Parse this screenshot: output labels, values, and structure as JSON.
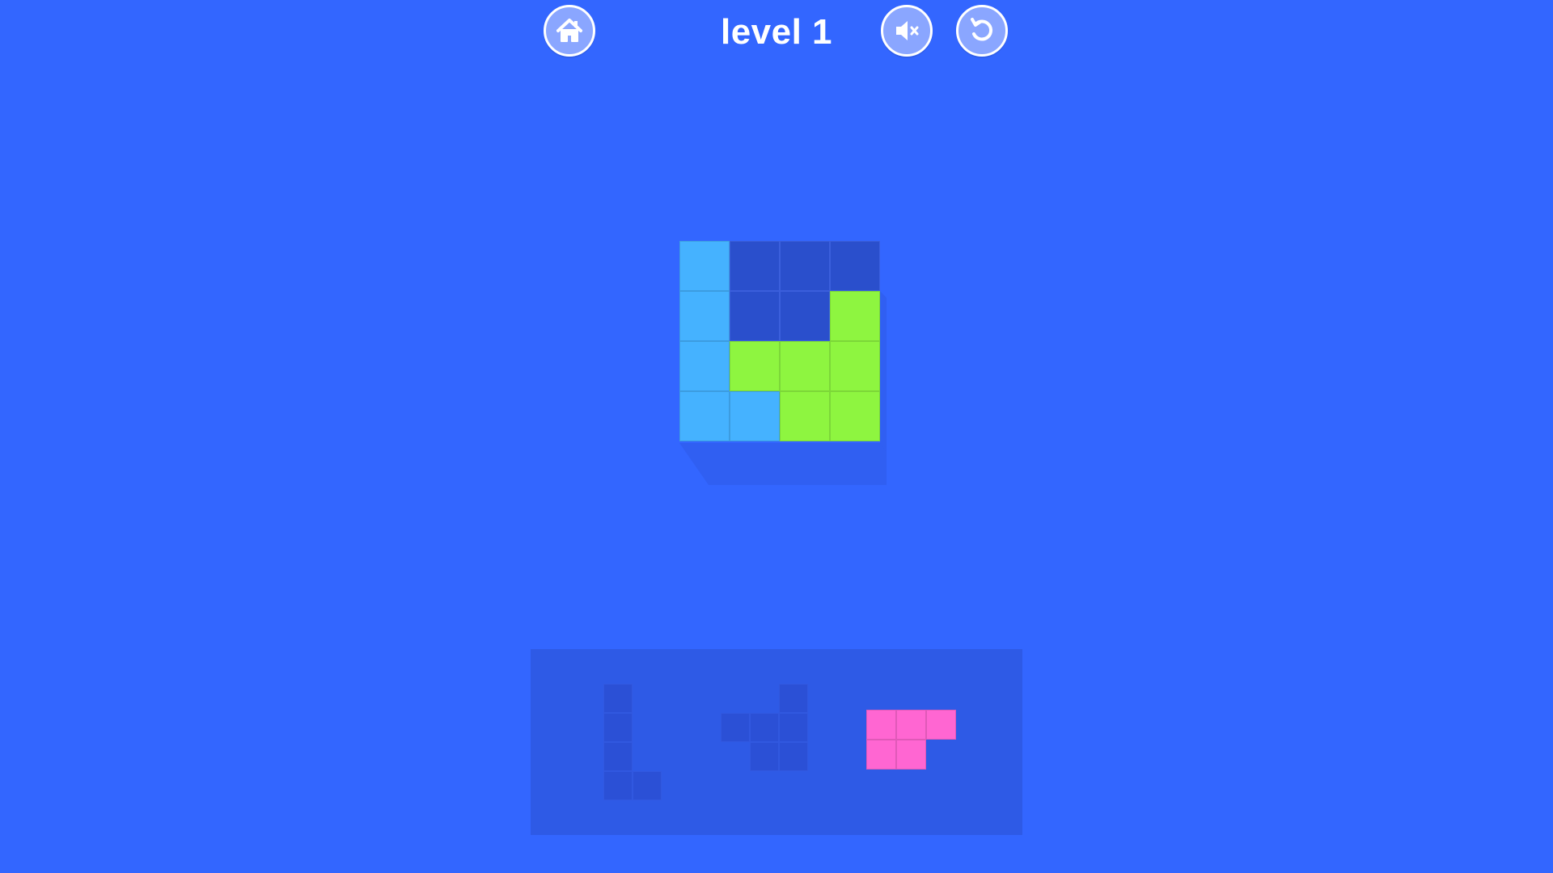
{
  "header": {
    "level_label": "level 1",
    "home_icon": "home-icon",
    "sound_icon": "sound-muted-icon",
    "restart_icon": "restart-icon"
  },
  "colors": {
    "background": "#3366ff",
    "board_empty": "#2a4fcc",
    "tray": "#2e5ae6",
    "tray_slot": "#2b50d6",
    "blue_piece": "#45b2ff",
    "green_piece": "#8ef540",
    "pink_piece": "#ff66d2",
    "button_fill": "#8aa6ff"
  },
  "board": {
    "cols": 4,
    "rows": 4,
    "cells": [
      [
        "blue",
        "empty",
        "empty",
        "empty"
      ],
      [
        "blue",
        "empty",
        "empty",
        "green"
      ],
      [
        "blue",
        "green",
        "green",
        "green"
      ],
      [
        "blue",
        "blue",
        "green",
        "green"
      ]
    ]
  },
  "tray": {
    "pieces": [
      {
        "name": "l-piece",
        "state": "placed",
        "color": "slot",
        "cells": [
          [
            0,
            0
          ],
          [
            0,
            1
          ],
          [
            0,
            2
          ],
          [
            0,
            3
          ],
          [
            1,
            3
          ]
        ]
      },
      {
        "name": "s-piece",
        "state": "placed",
        "color": "slot",
        "cells": [
          [
            2,
            0
          ],
          [
            0,
            1
          ],
          [
            1,
            1
          ],
          [
            2,
            1
          ],
          [
            1,
            2
          ],
          [
            2,
            2
          ]
        ]
      },
      {
        "name": "pink-piece",
        "state": "available",
        "color": "pink",
        "cells": [
          [
            0,
            0
          ],
          [
            1,
            0
          ],
          [
            2,
            0
          ],
          [
            0,
            1
          ],
          [
            1,
            1
          ]
        ]
      }
    ]
  }
}
